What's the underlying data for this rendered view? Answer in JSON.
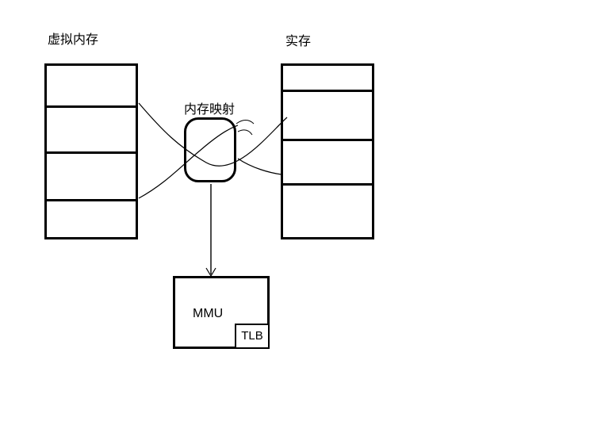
{
  "labels": {
    "virtual_memory": "虚拟内存",
    "real_memory": "实存",
    "memory_mapping": "内存映射",
    "mmu": "MMU",
    "tlb": "TLB"
  }
}
